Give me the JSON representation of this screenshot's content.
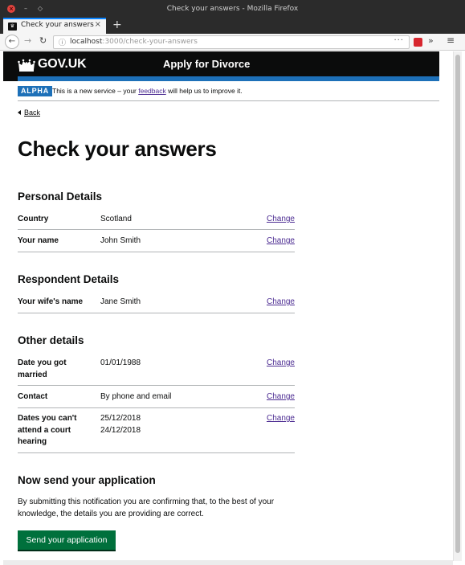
{
  "window": {
    "title": "Check your answers - Mozilla Firefox"
  },
  "tab": {
    "title": "Check your answers"
  },
  "url": {
    "host": "localhost",
    "path": ":3000/check-your-answers"
  },
  "header": {
    "logo_text": "GOV.UK",
    "service_name": "Apply for Divorce"
  },
  "phase_banner": {
    "tag": "ALPHA",
    "text_before": "This is a new service – your ",
    "link_text": "feedback",
    "text_after": " will help us to improve it."
  },
  "back_link": "Back",
  "page_title": "Check your answers",
  "sections": [
    {
      "heading": "Personal Details",
      "rows": [
        {
          "key": "Country",
          "value": "Scotland",
          "action": "Change"
        },
        {
          "key": "Your name",
          "value": "John Smith",
          "action": "Change"
        }
      ]
    },
    {
      "heading": "Respondent Details",
      "rows": [
        {
          "key": "Your wife's name",
          "value": "Jane Smith",
          "action": "Change"
        }
      ]
    },
    {
      "heading": "Other details",
      "rows": [
        {
          "key": "Date you got married",
          "value": "01/01/1988",
          "action": "Change"
        },
        {
          "key": "Contact",
          "value": "By phone and email",
          "action": "Change"
        },
        {
          "key": "Dates you can't attend a court hearing",
          "value": "25/12/2018\n24/12/2018",
          "action": "Change"
        }
      ]
    }
  ],
  "send": {
    "heading": "Now send your application",
    "declaration": "By submitting this notification you are confirming that, to the best of your knowledge, the details you are providing are correct.",
    "button": "Send your application"
  },
  "colors": {
    "header_bg": "#0b0c0c",
    "header_stripe": "#1d70b8",
    "phase_tag": "#1d70b8",
    "link_visited": "#4c2c92",
    "button_green": "#00703c"
  }
}
